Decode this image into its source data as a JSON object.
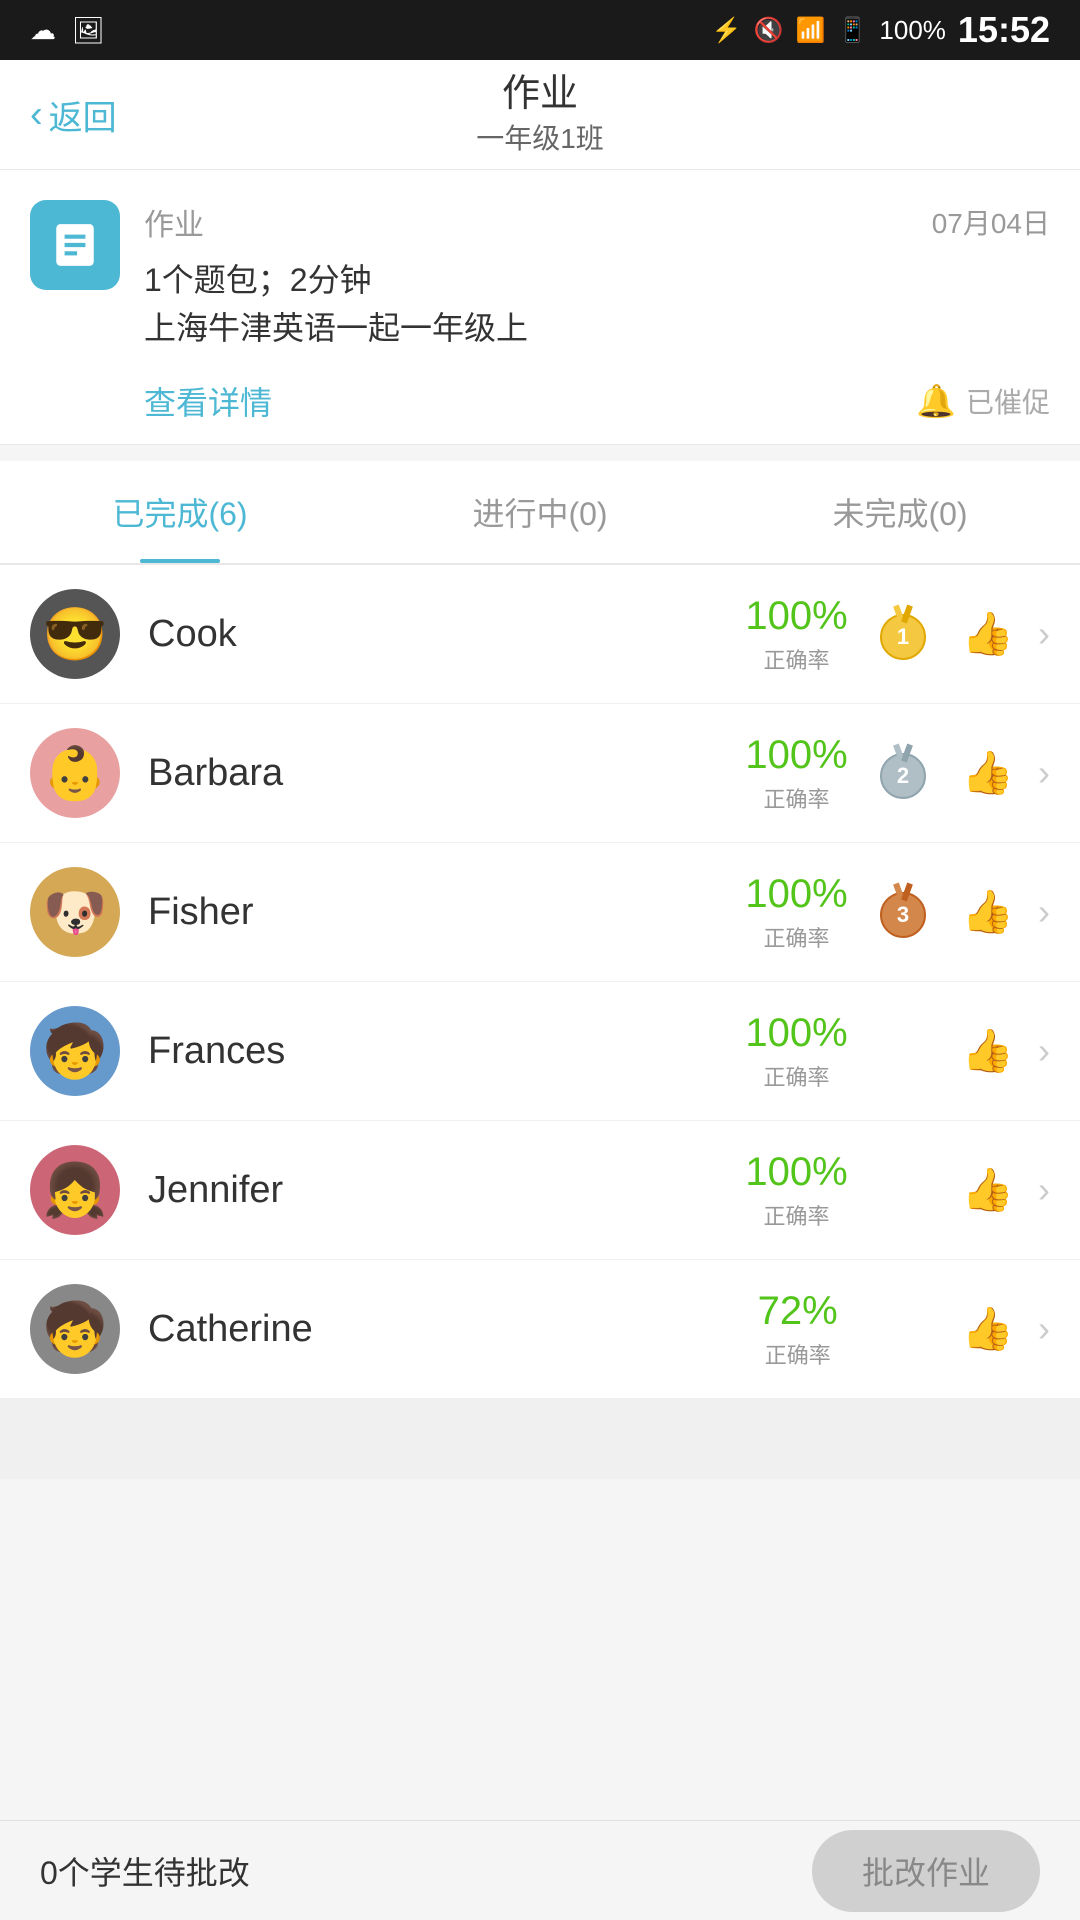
{
  "statusBar": {
    "time": "15:52",
    "battery": "100%",
    "icons": [
      "bluetooth",
      "mute",
      "wifi",
      "signal",
      "battery"
    ]
  },
  "header": {
    "backLabel": "返回",
    "title": "作业",
    "subtitle": "一年级1班"
  },
  "assignment": {
    "label": "作业",
    "date": "07月04日",
    "line1": "1个题包；2分钟",
    "line2": "上海牛津英语一起一年级上",
    "viewDetail": "查看详情",
    "urged": "已催促"
  },
  "tabs": [
    {
      "label": "已完成(6)",
      "active": true
    },
    {
      "label": "进行中(0)",
      "active": false
    },
    {
      "label": "未完成(0)",
      "active": false
    }
  ],
  "students": [
    {
      "id": "cook",
      "name": "Cook",
      "score": "100%",
      "scoreLabel": "正确率",
      "medal": "gold",
      "rank": "1"
    },
    {
      "id": "barbara",
      "name": "Barbara",
      "score": "100%",
      "scoreLabel": "正确率",
      "medal": "silver",
      "rank": "2"
    },
    {
      "id": "fisher",
      "name": "Fisher",
      "score": "100%",
      "scoreLabel": "正确率",
      "medal": "bronze",
      "rank": "3"
    },
    {
      "id": "frances",
      "name": "Frances",
      "score": "100%",
      "scoreLabel": "正确率",
      "medal": "none",
      "rank": ""
    },
    {
      "id": "jennifer",
      "name": "Jennifer",
      "score": "100%",
      "scoreLabel": "正确率",
      "medal": "none",
      "rank": ""
    },
    {
      "id": "catherine",
      "name": "Catherine",
      "score": "72%",
      "scoreLabel": "正确率",
      "medal": "none",
      "rank": ""
    }
  ],
  "bottomBar": {
    "pendingText": "0个学生待批改",
    "gradeButton": "批改作业"
  },
  "colors": {
    "primary": "#4db8d4",
    "gold": "#f5a623",
    "silver": "#a0a8b8",
    "bronze": "#d4874a",
    "green": "#52c41a"
  }
}
